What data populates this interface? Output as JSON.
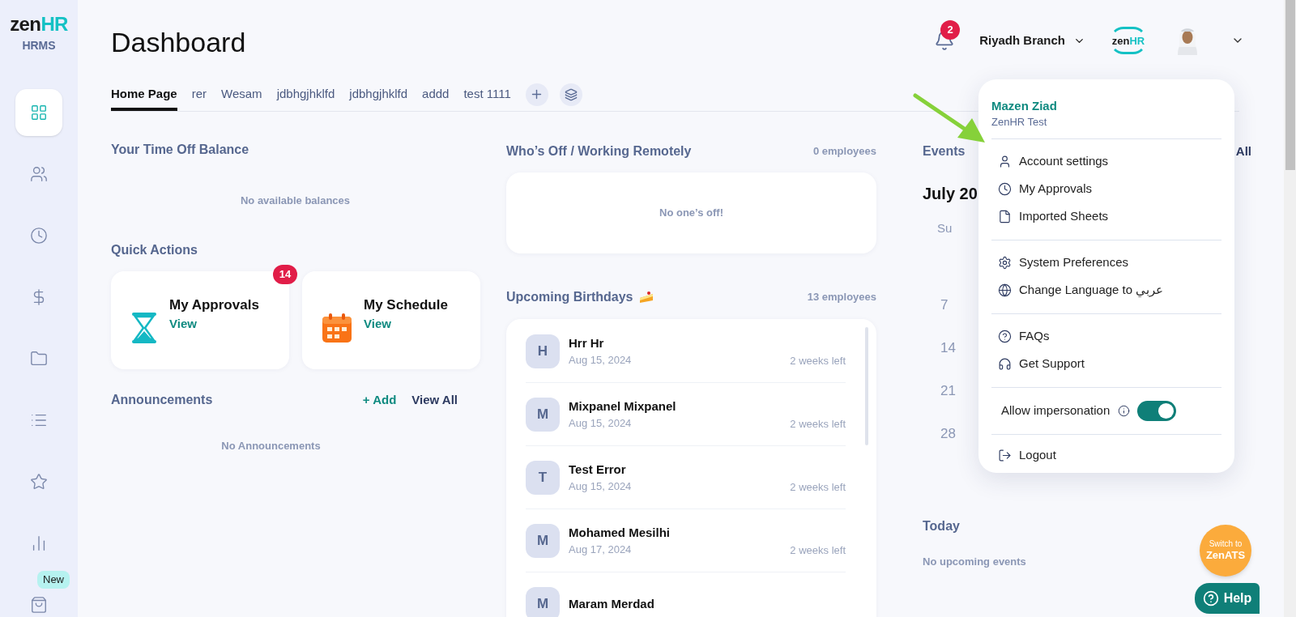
{
  "sidebar": {
    "logo": {
      "part_a": "zen",
      "part_b": "HR",
      "product": "HRMS"
    },
    "items": [
      {
        "kind": "grid",
        "selected": true
      },
      {
        "kind": "people",
        "selected": false
      },
      {
        "kind": "clock",
        "selected": false
      },
      {
        "kind": "dollar",
        "selected": false
      },
      {
        "kind": "folder",
        "selected": false
      },
      {
        "kind": "list",
        "selected": false
      },
      {
        "kind": "star",
        "selected": false
      },
      {
        "kind": "chart",
        "selected": false
      },
      {
        "kind": "bag",
        "selected": false,
        "badge": "New"
      }
    ]
  },
  "header": {
    "title": "Dashboard",
    "notifications": "2",
    "branch": "Riyadh Branch",
    "logo": {
      "part_a": "zen",
      "part_b": "HR"
    }
  },
  "tabs": [
    {
      "label": "Home Page",
      "selected": true
    },
    {
      "label": "rer",
      "selected": false
    },
    {
      "label": "Wesam",
      "selected": false
    },
    {
      "label": "jdbhgjhklfd",
      "selected": false
    },
    {
      "label": "jdbhgjhklfd",
      "selected": false
    },
    {
      "label": "addd",
      "selected": false
    },
    {
      "label": "test 1111",
      "selected": false
    }
  ],
  "time_off": {
    "title": "Your Time Off Balance",
    "empty": "No available balances"
  },
  "quick_actions": {
    "title": "Quick Actions",
    "items": [
      {
        "kind": "hourglass",
        "label": "My Approvals",
        "link": "View",
        "badge": "14"
      },
      {
        "kind": "calendar",
        "label": "My Schedule",
        "link": "View"
      }
    ]
  },
  "announcements": {
    "title": "Announcements",
    "add": "+ Add",
    "view_all": "View All",
    "empty": "No Announcements"
  },
  "whos_off": {
    "title": "Who’s Off / Working Remotely",
    "count": "0 employees",
    "empty": "No one’s off!"
  },
  "birthdays": {
    "title": "Upcoming Birthdays",
    "count": "13 employees",
    "items": [
      {
        "initial": "H",
        "name": "Hrr Hr",
        "date": "Aug 15, 2024",
        "left": "2 weeks left"
      },
      {
        "initial": "M",
        "name": "Mixpanel Mixpanel",
        "date": "Aug 15, 2024",
        "left": "2 weeks left"
      },
      {
        "initial": "T",
        "name": "Test Error",
        "date": "Aug 15, 2024",
        "left": "2 weeks left"
      },
      {
        "initial": "M",
        "name": "Mohamed Mesilhi",
        "date": "Aug 17, 2024",
        "left": "2 weeks left"
      },
      {
        "initial": "M",
        "name": "Maram Merdad"
      }
    ]
  },
  "events": {
    "title": "Events",
    "view_all": "All",
    "month": "July 20",
    "weekday": "Su",
    "dates": [
      "7",
      "14",
      "21",
      "28"
    ],
    "today_title": "Today",
    "today_empty": "No upcoming events"
  },
  "account_menu": {
    "name": "Mazen Ziad",
    "company": "ZenHR Test",
    "groups": [
      [
        {
          "kind": "user",
          "label": "Account settings"
        },
        {
          "kind": "clock",
          "label": "My Approvals"
        },
        {
          "kind": "file",
          "label": "Imported Sheets"
        }
      ],
      [
        {
          "kind": "gear",
          "label": "System Preferences"
        },
        {
          "kind": "globe",
          "label": "Change Language to عربي"
        }
      ],
      [
        {
          "kind": "question",
          "label": "FAQs"
        },
        {
          "kind": "headset",
          "label": "Get Support"
        }
      ]
    ],
    "toggle": {
      "label": "Allow impersonation",
      "on": true
    },
    "logout": "Logout"
  },
  "switch_button": {
    "line_1": "Switch to",
    "line_2": "ZenATS"
  },
  "help_button": "Help"
}
